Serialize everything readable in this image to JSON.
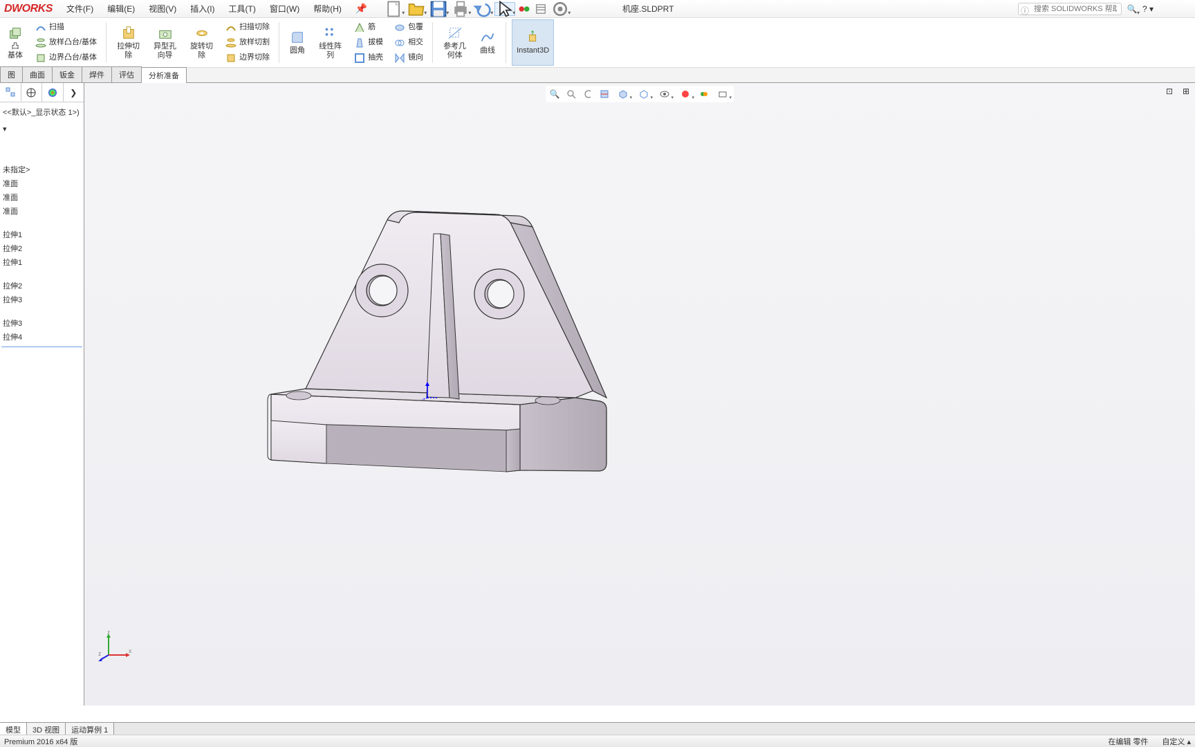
{
  "app": {
    "logo": "DWORKS",
    "doc_title": "机座.SLDPRT"
  },
  "menu": [
    {
      "label": "文件(F)"
    },
    {
      "label": "编辑(E)"
    },
    {
      "label": "视图(V)"
    },
    {
      "label": "插入(I)"
    },
    {
      "label": "工具(T)"
    },
    {
      "label": "窗口(W)"
    },
    {
      "label": "帮助(H)"
    }
  ],
  "search": {
    "placeholder": "搜索 SOLIDWORKS 帮助"
  },
  "ribbon": {
    "sweep": "扫描",
    "loft": "放样凸台/基体",
    "boundary": "边界凸台/基体",
    "extrude_cut": "拉伸切\n除",
    "hole": "异型孔\n向导",
    "revolve_cut": "旋转切\n除",
    "swept_cut": "扫描切除",
    "loft_cut": "放样切割",
    "boundary_cut": "边界切除",
    "fillet": "圆角",
    "linear_pattern": "线性阵\n列",
    "rib": "筋",
    "draft": "拔模",
    "shell": "抽壳",
    "wrap": "包覆",
    "intersect": "相交",
    "mirror": "镜向",
    "ref_geom": "参考几\n何体",
    "curves": "曲线",
    "instant3d": "Instant3D",
    "extrude_base": "凸\n基体"
  },
  "command_tabs": [
    "图",
    "曲面",
    "钣金",
    "焊件",
    "评估",
    "分析准备"
  ],
  "tree": {
    "state": "<<默认>_显示状态 1>)",
    "items": [
      "未指定>",
      "准面",
      "准面",
      "准面",
      "拉伸1",
      "拉伸2",
      "拉伸1",
      "拉伸2",
      "拉伸3",
      "拉伸3",
      "拉伸4"
    ]
  },
  "bottom_tabs": [
    "模型",
    "3D 视图",
    "运动算例 1"
  ],
  "status": {
    "version": "Premium 2016 x64 版",
    "edit": "在编辑 零件",
    "custom": "自定义"
  },
  "triad": {
    "x": "x",
    "y": "y",
    "z": "z"
  }
}
